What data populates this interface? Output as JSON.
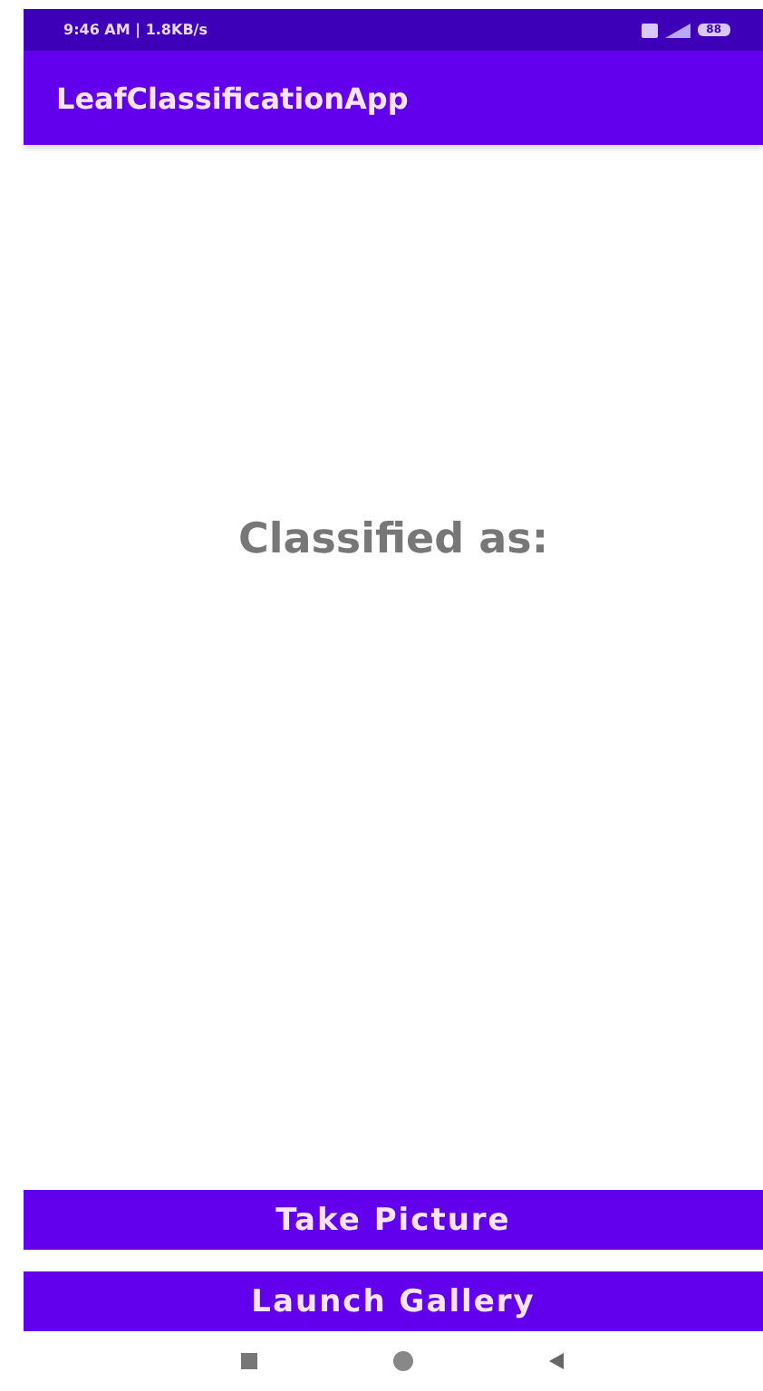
{
  "status_bar": {
    "time": "9:46 AM | 1.8KB/s",
    "battery": "88"
  },
  "app_bar": {
    "title": "LeafClassificationApp"
  },
  "result": {
    "label": "Classified as:"
  },
  "buttons": [
    "Take Picture",
    "Launch Gallery"
  ]
}
